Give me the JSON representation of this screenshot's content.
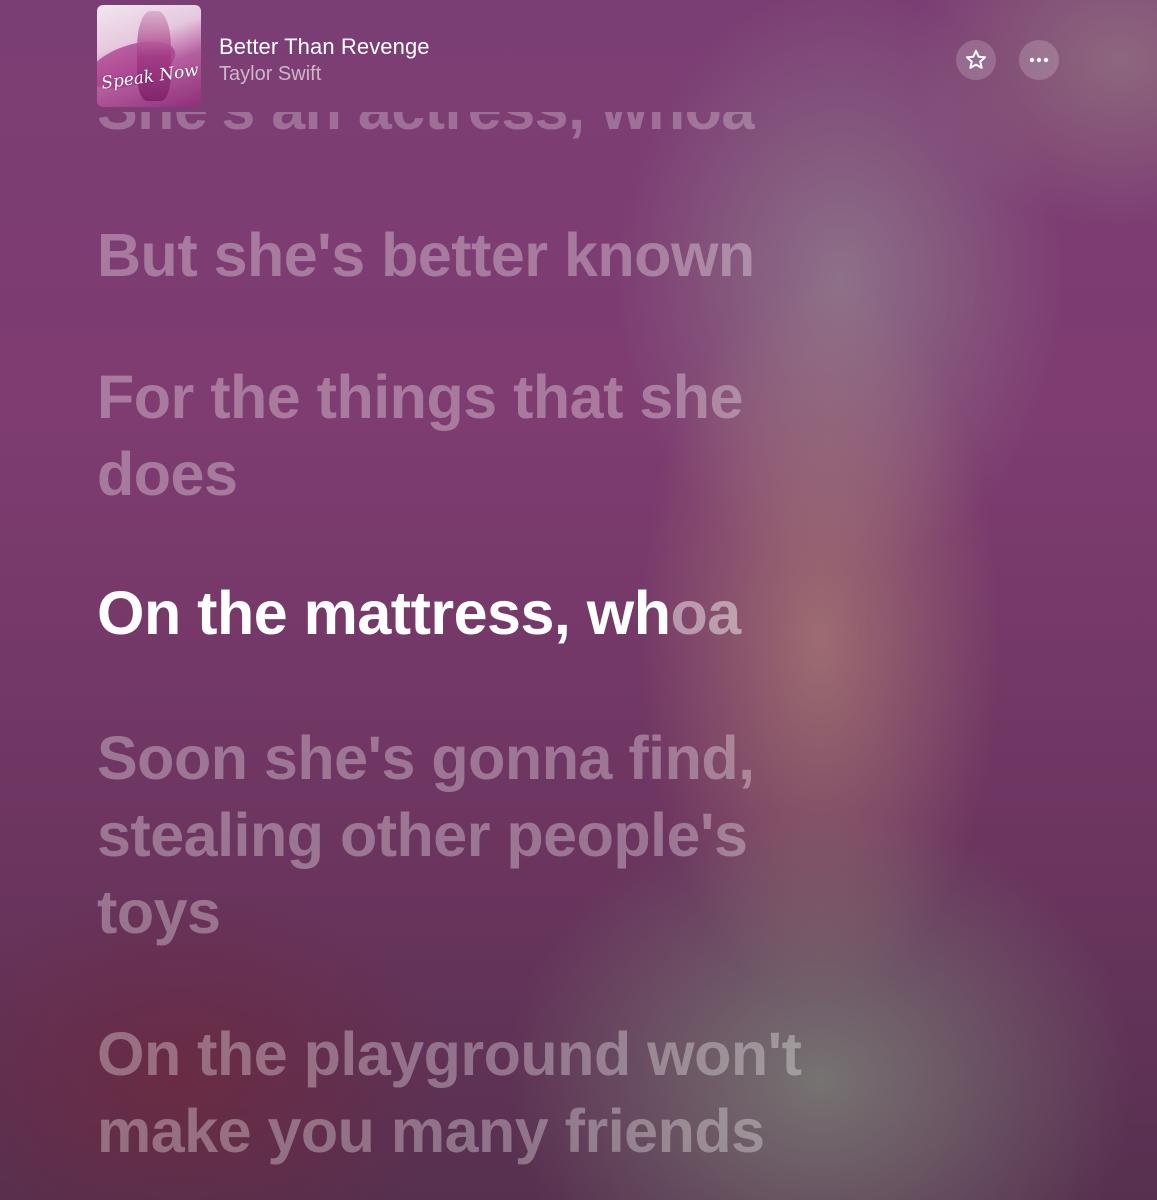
{
  "track": {
    "title": "Better Than Revenge",
    "artist": "Taylor Swift",
    "album_art_text": "Speak Now"
  },
  "actions": {
    "favorite_icon": "star-icon",
    "more_icon": "ellipsis-icon"
  },
  "lyrics": {
    "previous_partial": "She's an actress, whoa",
    "line_1": "But she's better known",
    "line_2a": "For the things that she",
    "line_2b": "does",
    "active_sung": "On the mattress, wh",
    "active_unsung": "oa",
    "line_4a": "Soon she's gonna find,",
    "line_4b": "stealing other people's",
    "line_4c": "toys",
    "line_5a": "On the playground won't",
    "line_5b": "make you many friends"
  },
  "colors": {
    "active_text": "#ffffff",
    "accent_background": "#7b3e74"
  }
}
